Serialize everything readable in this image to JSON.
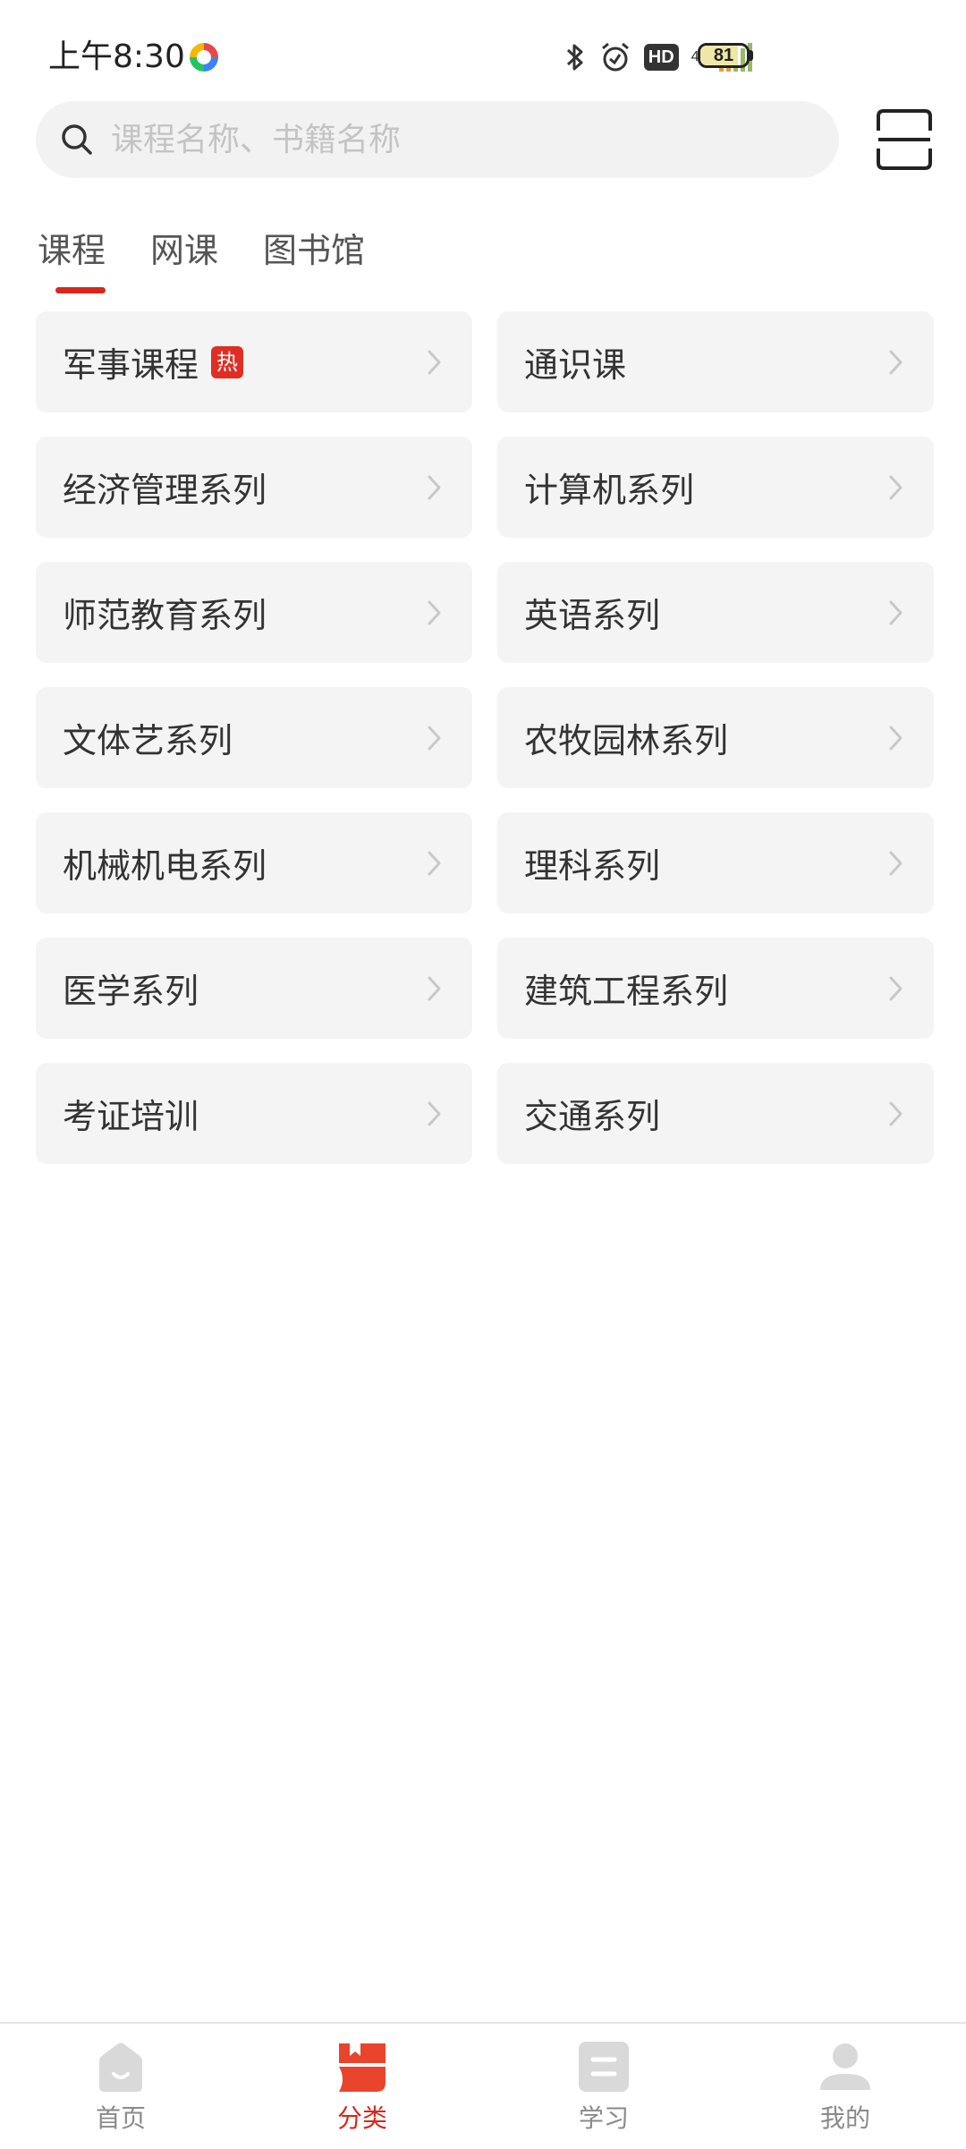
{
  "status_bar": {
    "time": "上午8:30",
    "network": "4G",
    "hd": "HD",
    "battery": "81",
    "battery_level": 0.81
  },
  "search": {
    "placeholder": "课程名称、书籍名称",
    "value": ""
  },
  "tabs": [
    {
      "label": "课程",
      "active": true
    },
    {
      "label": "网课",
      "active": false
    },
    {
      "label": "图书馆",
      "active": false
    }
  ],
  "categories": [
    {
      "label": "军事课程",
      "badge": "热"
    },
    {
      "label": "通识课"
    },
    {
      "label": "经济管理系列"
    },
    {
      "label": "计算机系列"
    },
    {
      "label": "师范教育系列"
    },
    {
      "label": "英语系列"
    },
    {
      "label": "文体艺系列"
    },
    {
      "label": "农牧园林系列"
    },
    {
      "label": "机械机电系列"
    },
    {
      "label": "理科系列"
    },
    {
      "label": "医学系列"
    },
    {
      "label": "建筑工程系列"
    },
    {
      "label": "考证培训"
    },
    {
      "label": "交通系列"
    }
  ],
  "bottom_nav": [
    {
      "label": "首页",
      "icon": "home-icon",
      "active": false
    },
    {
      "label": "分类",
      "icon": "category-icon",
      "active": true
    },
    {
      "label": "学习",
      "icon": "study-icon",
      "active": false
    },
    {
      "label": "我的",
      "icon": "profile-icon",
      "active": false
    }
  ],
  "colors": {
    "accent": "#d9261c",
    "badge": "#e02e24",
    "card_bg": "#f4f4f4",
    "search_bg": "#f2f2f2",
    "nav_inactive": "#d9d9d9"
  }
}
